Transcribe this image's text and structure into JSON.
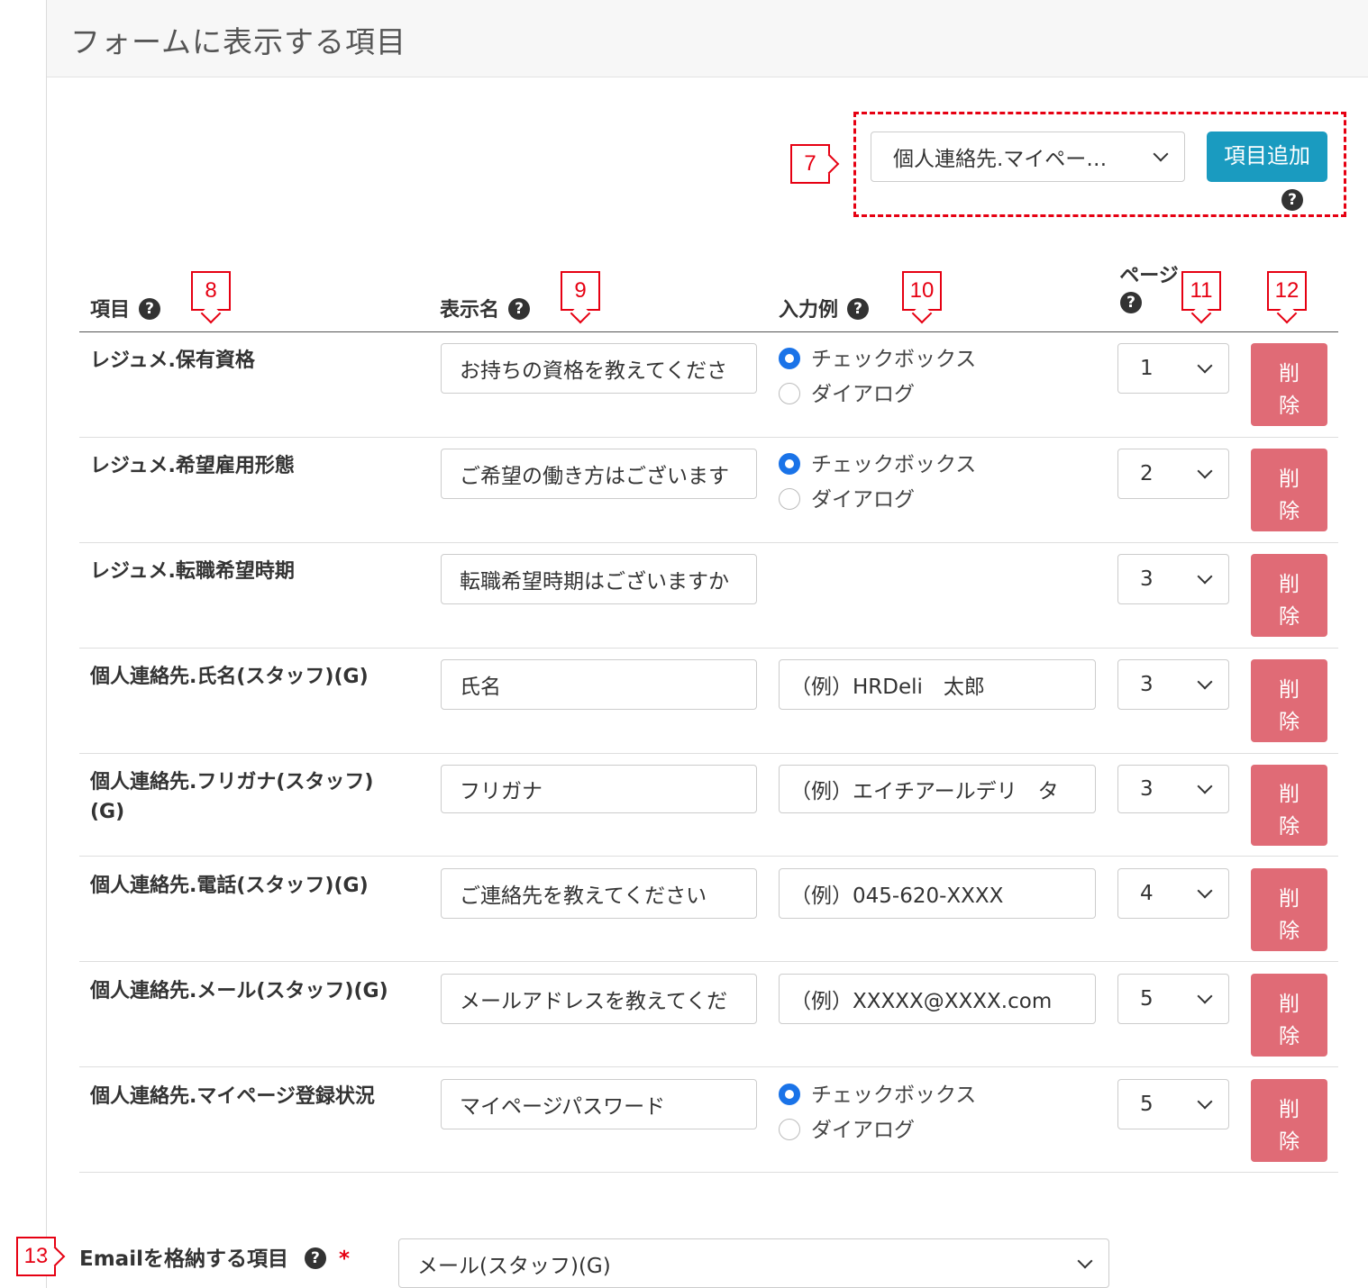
{
  "header": {
    "title": "フォームに表示する項目"
  },
  "add_item": {
    "select_value": "個人連絡先.マイペー…",
    "button_label": "項目追加",
    "help": "?"
  },
  "callouts": [
    "7",
    "8",
    "9",
    "10",
    "11",
    "12",
    "13"
  ],
  "table": {
    "headers": {
      "item": "項目",
      "display_name": "表示名",
      "input_example": "入力例",
      "page": "ページ"
    },
    "help": "?",
    "radio_options": [
      "チェックボックス",
      "ダイアログ"
    ],
    "delete_label": [
      "削",
      "除"
    ],
    "rows": [
      {
        "item": "レジュメ.保有資格",
        "display_name": "お持ちの資格を教えてくださ",
        "example": "",
        "radio_selected": "チェックボックス",
        "page": "1"
      },
      {
        "item": "レジュメ.希望雇用形態",
        "display_name": "ご希望の働き方はございます",
        "example": "",
        "radio_selected": "チェックボックス",
        "page": "2"
      },
      {
        "item": "レジュメ.転職希望時期",
        "display_name": "転職希望時期はございますか",
        "example": "",
        "page": "3"
      },
      {
        "item": "個人連絡先.氏名(スタッフ)(G)",
        "display_name": "氏名",
        "example": "（例）HRDeli　太郎",
        "page": "3"
      },
      {
        "item": "個人連絡先.フリガナ(スタッフ)",
        "item_line2": "(G)",
        "display_name": "フリガナ",
        "example": "（例）エイチアールデリ　タ",
        "page": "3"
      },
      {
        "item": "個人連絡先.電話(スタッフ)(G)",
        "display_name": "ご連絡先を教えてください",
        "example": "（例）045-620-XXXX",
        "page": "4"
      },
      {
        "item": "個人連絡先.メール(スタッフ)(G)",
        "display_name": "メールアドレスを教えてくだ",
        "example": "（例）XXXXX@XXXX.com",
        "page": "5"
      },
      {
        "item": "個人連絡先.マイページ登録状況",
        "display_name": "マイページパスワード",
        "example": "",
        "radio_selected": "チェックボックス",
        "page": "5"
      }
    ]
  },
  "email_field": {
    "label": "Emailを格納する項目",
    "required_mark": "*",
    "select_value": "メール(スタッフ)(G)"
  },
  "colors": {
    "primary_button": "#1a9bc0",
    "delete_button": "#e06b76",
    "callout": "#e60012",
    "radio_selected": "#1a73e8"
  }
}
